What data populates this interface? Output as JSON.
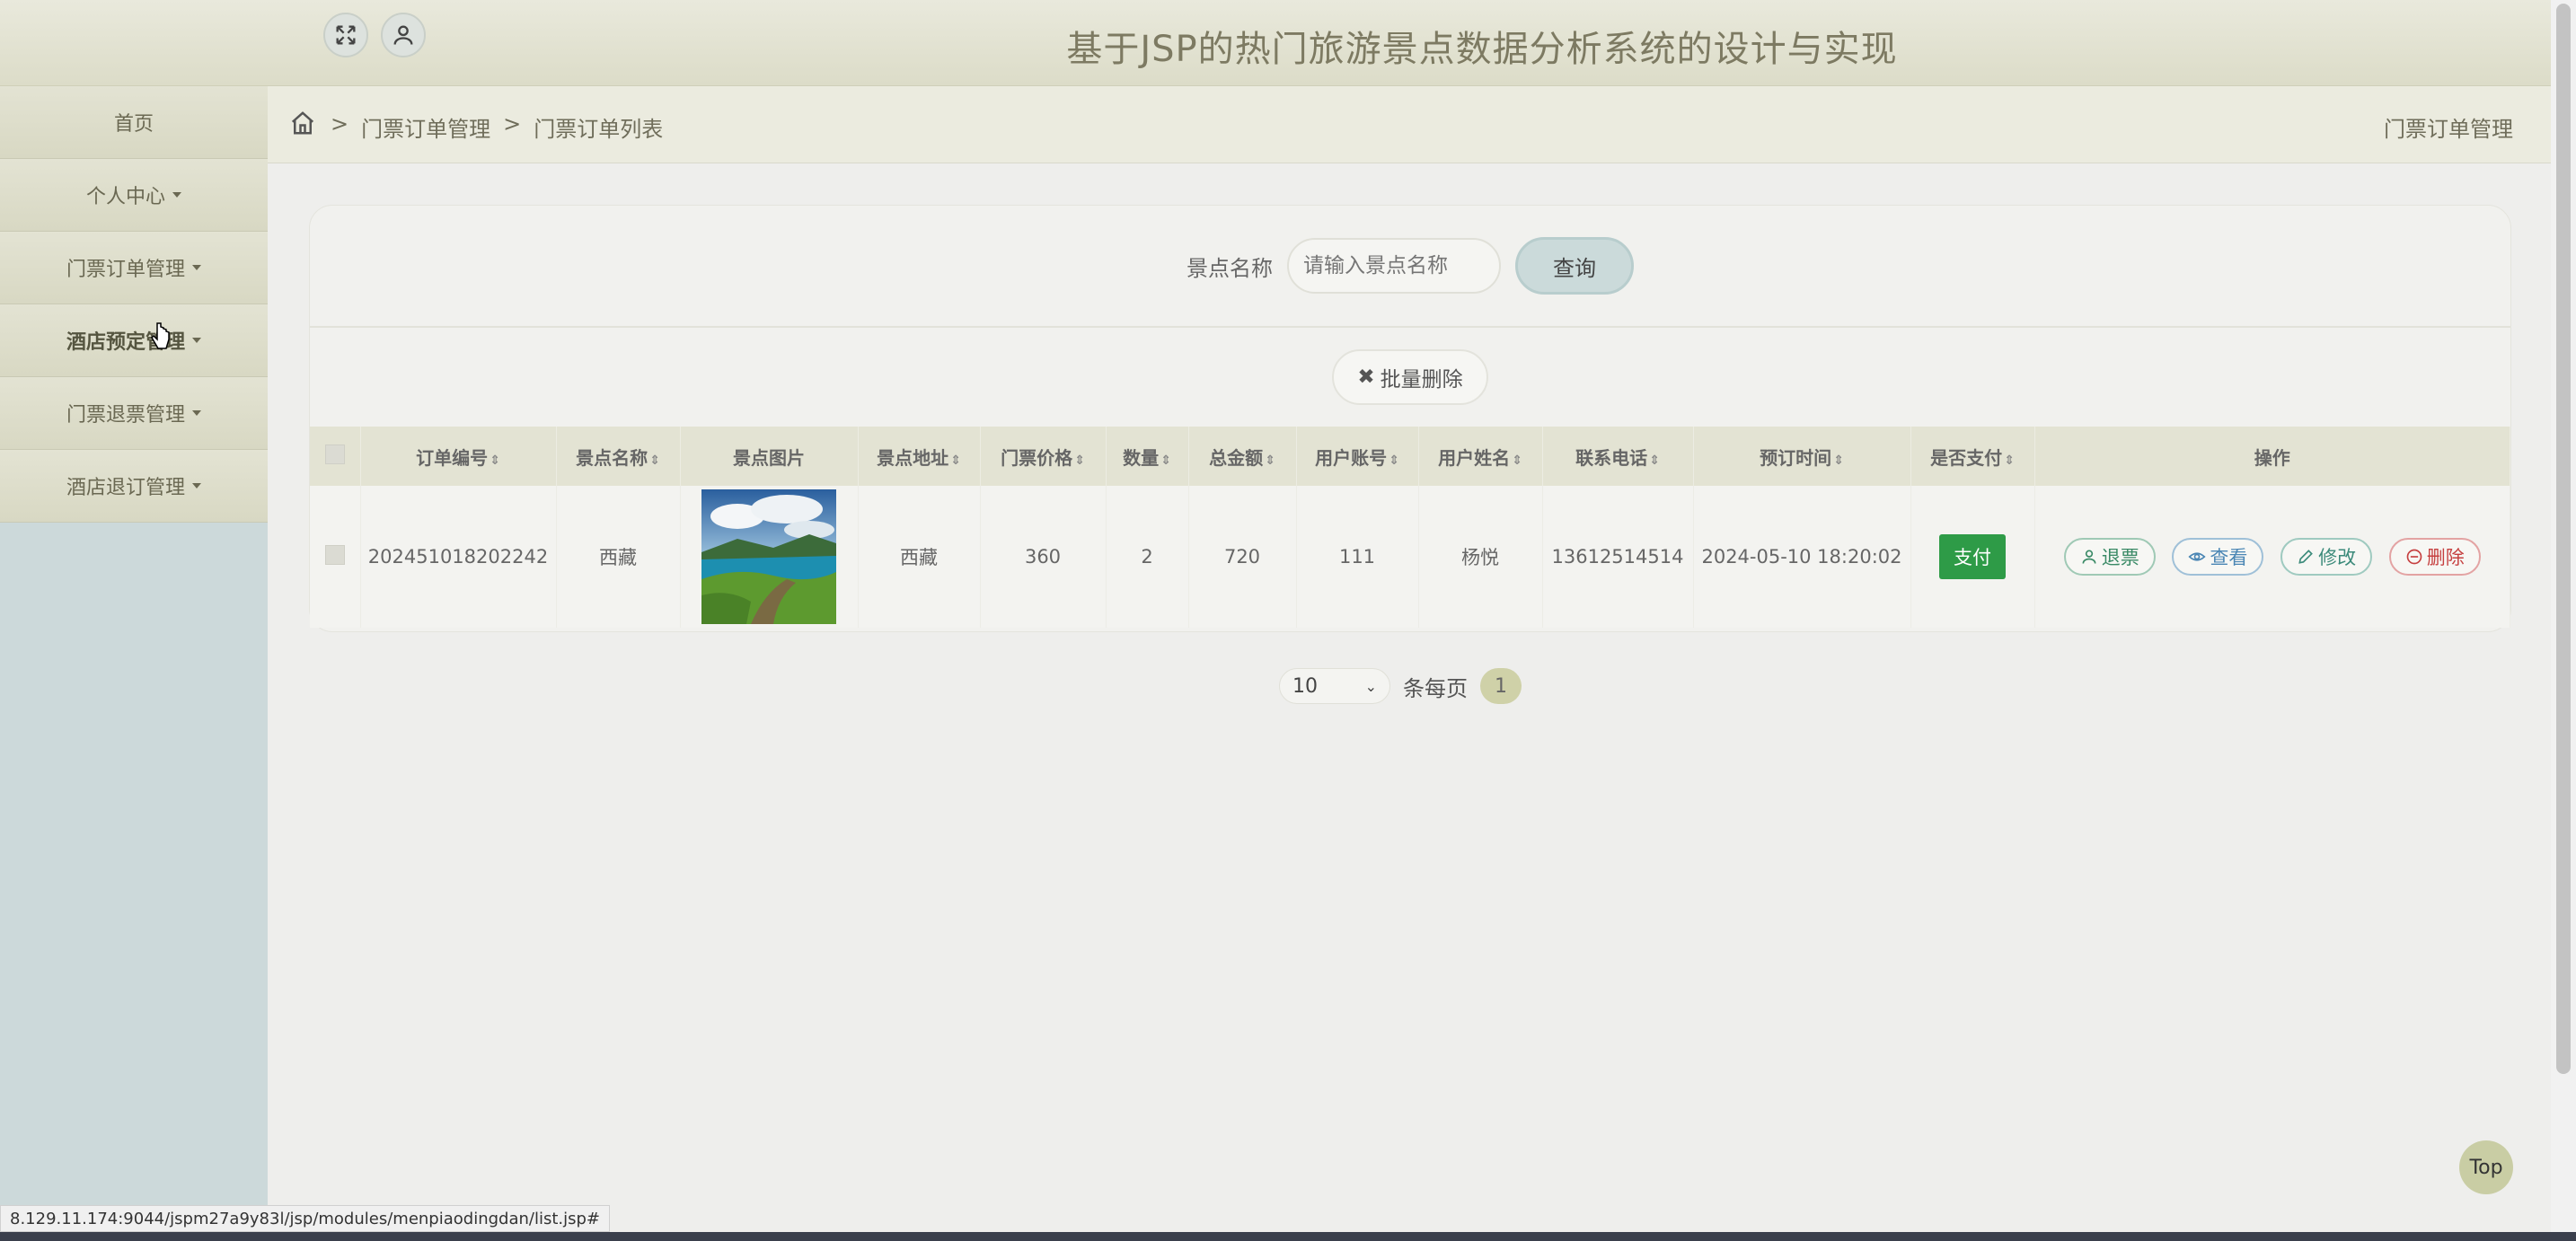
{
  "header": {
    "title": "基于JSP的热门旅游景点数据分析系统的设计与实现",
    "fullscreen_icon": "expand-icon",
    "user_icon": "user-icon"
  },
  "sidebar": {
    "items": [
      {
        "label": "首页",
        "dropdown": false
      },
      {
        "label": "个人中心",
        "dropdown": true
      },
      {
        "label": "门票订单管理",
        "dropdown": true
      },
      {
        "label": "酒店预定管理",
        "dropdown": true
      },
      {
        "label": "门票退票管理",
        "dropdown": true
      },
      {
        "label": "酒店退订管理",
        "dropdown": true
      }
    ]
  },
  "breadcrumb": {
    "sep": ">",
    "items": [
      "门票订单管理",
      "门票订单列表"
    ],
    "right_title": "门票订单管理"
  },
  "search": {
    "label": "景点名称",
    "placeholder": "请输入景点名称",
    "button": "查询"
  },
  "batch_delete": "批量删除",
  "table": {
    "columns": [
      "订单编号",
      "景点名称",
      "景点图片",
      "景点地址",
      "门票价格",
      "数量",
      "总金额",
      "用户账号",
      "用户姓名",
      "联系电话",
      "预订时间",
      "是否支付",
      "操作"
    ],
    "rows": [
      {
        "order_no": "202451018202242",
        "spot_name": "西藏",
        "spot_address": "西藏",
        "price": "360",
        "quantity": "2",
        "total": "720",
        "account": "111",
        "user_name": "杨悦",
        "phone": "13612514514",
        "time": "2024-05-10 18:20:02",
        "pay_label": "支付",
        "actions": {
          "refund": "退票",
          "view": "查看",
          "edit": "修改",
          "delete": "删除"
        }
      }
    ]
  },
  "pager": {
    "page_size": "10",
    "per_page_label": "条每页",
    "current_page": "1"
  },
  "top_button": "Top",
  "status_url": "8.129.11.174:9044/jspm27a9y83l/jsp/modules/menpiaodingdan/list.jsp#",
  "colors": {
    "pay_green": "#2e9b47",
    "delete_red": "#c64040",
    "header_bg": "#dcdcc8"
  }
}
